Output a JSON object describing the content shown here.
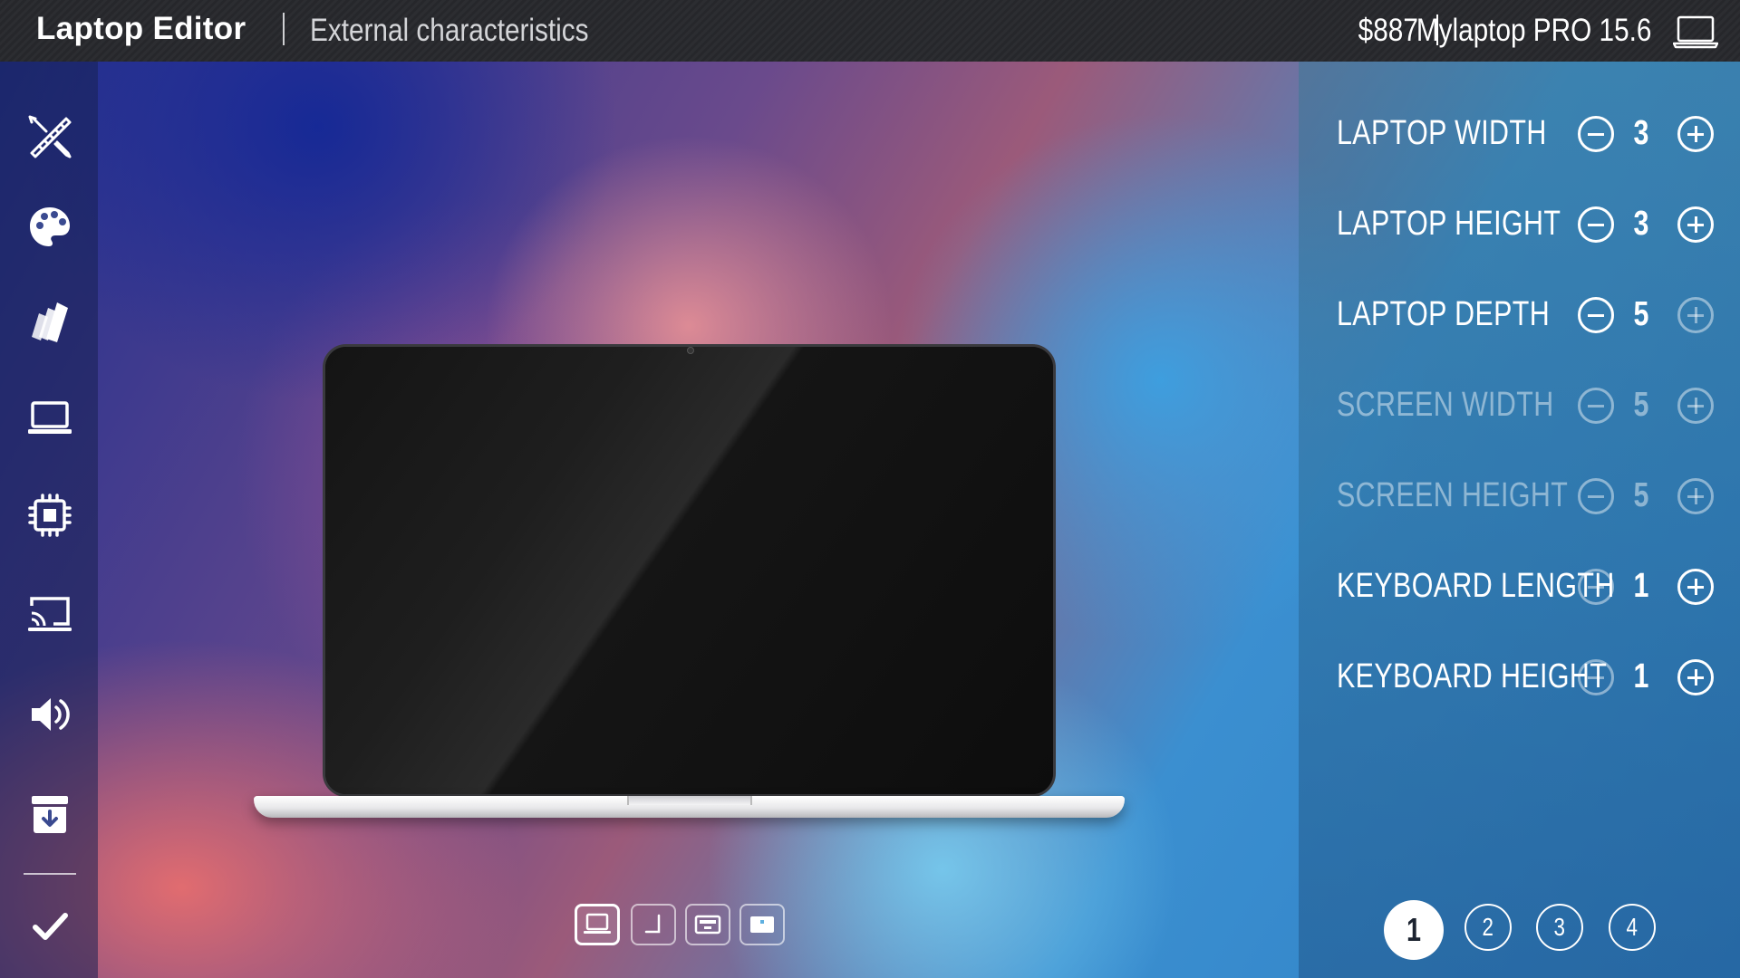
{
  "header": {
    "app_title": "Laptop Editor",
    "section_title": "External characteristics",
    "price": "$887",
    "model_name": "Mylaptop PRO 15.6",
    "model_icon": "laptop-outline-icon"
  },
  "sidebar": {
    "items": [
      {
        "icon": "ruler-pencil-icon",
        "label": "Dimensions"
      },
      {
        "icon": "palette-icon",
        "label": "Colors"
      },
      {
        "icon": "swatches-icon",
        "label": "Materials"
      },
      {
        "icon": "laptop-icon",
        "label": "Laptop"
      },
      {
        "icon": "cpu-icon",
        "label": "Processor"
      },
      {
        "icon": "screen-cast-icon",
        "label": "Display"
      },
      {
        "icon": "speaker-icon",
        "label": "Sound"
      },
      {
        "icon": "download-box-icon",
        "label": "Save"
      }
    ],
    "confirm_icon": "checkmark-icon"
  },
  "panel": {
    "rows": [
      {
        "label": "LAPTOP WIDTH",
        "value": "3",
        "enabled": true
      },
      {
        "label": "LAPTOP HEIGHT",
        "value": "3",
        "enabled": true
      },
      {
        "label": "LAPTOP DEPTH",
        "value": "5",
        "enabled": true
      },
      {
        "label": "SCREEN WIDTH",
        "value": "5",
        "enabled": false
      },
      {
        "label": "SCREEN HEIGHT",
        "value": "5",
        "enabled": false
      },
      {
        "label": "KEYBOARD LENGTH",
        "value": "1",
        "enabled": true
      },
      {
        "label": "KEYBOARD HEIGHT",
        "value": "1",
        "enabled": true
      }
    ],
    "pages": [
      "1",
      "2",
      "3",
      "4"
    ],
    "active_page": "1"
  },
  "view_modes": [
    {
      "icon": "front-view-icon",
      "active": true
    },
    {
      "icon": "side-view-icon",
      "active": false
    },
    {
      "icon": "top-view-icon",
      "active": false
    },
    {
      "icon": "screen-view-icon",
      "active": false
    }
  ],
  "colors": {
    "topbar": "#2a2b2f",
    "screen": "#101010",
    "base": "#e8e8ea"
  }
}
